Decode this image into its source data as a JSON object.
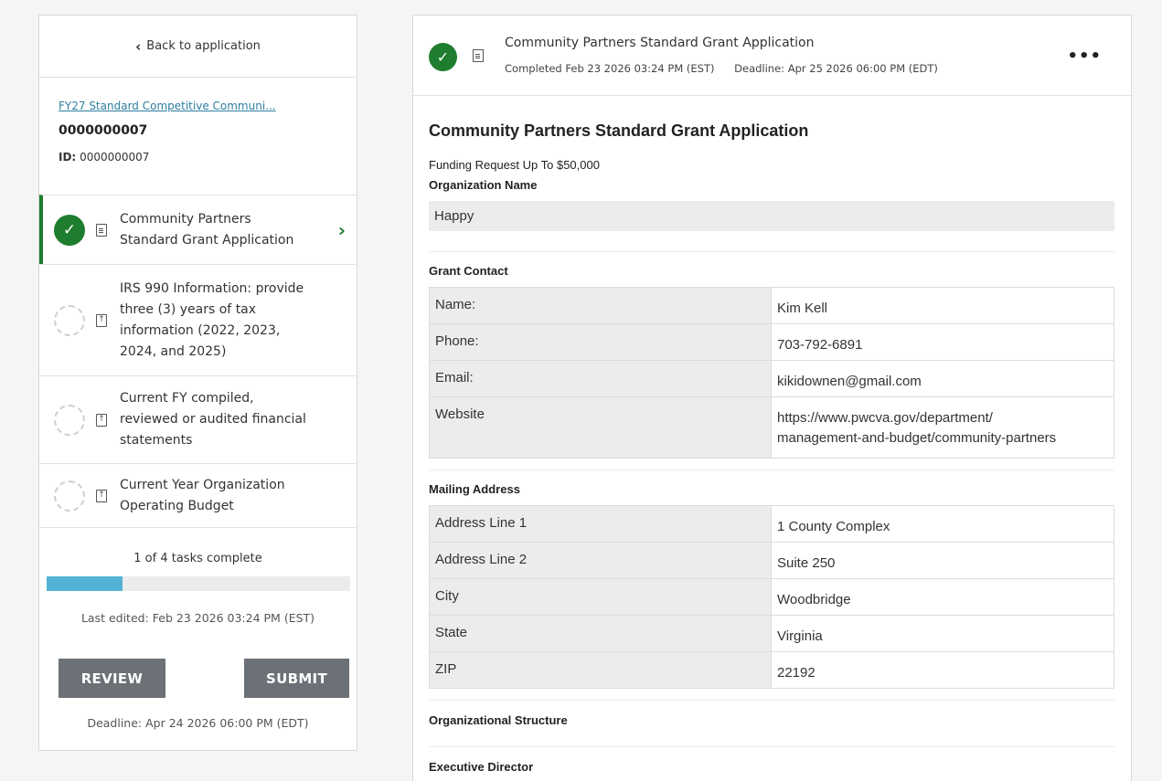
{
  "sidebar": {
    "back_label": "Back to application",
    "program_link": "FY27 Standard Competitive Communi...",
    "app_number": "0000000007",
    "id_label": "ID:",
    "id_value": "0000000007",
    "tasks": [
      {
        "label": "Community Partners Standard Grant Application",
        "status": "complete",
        "icon": "document-icon"
      },
      {
        "label": "IRS 990 Information: provide three (3) years of tax information (2022, 2023, 2024, and 2025)",
        "status": "incomplete",
        "icon": "upload-icon"
      },
      {
        "label": "Current FY compiled, reviewed or audited financial statements",
        "status": "incomplete",
        "icon": "upload-icon"
      },
      {
        "label": "Current Year Organization Operating Budget",
        "status": "incomplete",
        "icon": "upload-icon"
      }
    ],
    "progress_text": "1 of 4 tasks complete",
    "progress_fraction": 0.25,
    "last_edited": "Last edited: Feb 23 2026 03:24 PM (EST)",
    "review_label": "REVIEW",
    "submit_label": "SUBMIT",
    "deadline": "Deadline: Apr 24 2026 06:00 PM (EDT)"
  },
  "colors": {
    "complete_green": "#1e7d2e",
    "progress_blue": "#52b3d4",
    "button_gray": "#6b7176",
    "link_blue": "#2e7fa0"
  },
  "main": {
    "header_title": "Community Partners Standard Grant Application",
    "completed": "Completed Feb 23 2026 03:24 PM (EST)",
    "deadline": "Deadline: Apr 25 2026 06:00 PM (EDT)",
    "more_label": "•••",
    "form_title": "Community Partners Standard Grant Application",
    "form_subtitle": "Funding Request Up To $50,000",
    "org_name_label": "Organization Name",
    "org_name_value": "Happy",
    "grant_contact_label": "Grant Contact",
    "grant_contact": [
      {
        "key": "Name:",
        "value": "Kim Kell"
      },
      {
        "key": "Phone:",
        "value": "703-792-6891"
      },
      {
        "key": "Email:",
        "value": "kikidownen@gmail.com"
      },
      {
        "key": "Website",
        "value_line1": "https://www.pwcva.gov/department/",
        "value_line2": "management-and-budget/community-partners"
      }
    ],
    "mailing_address_label": "Mailing Address",
    "mailing_address": [
      {
        "key": "Address Line 1",
        "value": "1 County Complex"
      },
      {
        "key": "Address Line 2",
        "value": "Suite 250"
      },
      {
        "key": "City",
        "value": "Woodbridge"
      },
      {
        "key": "State",
        "value": "Virginia"
      },
      {
        "key": "ZIP",
        "value": "22192"
      }
    ],
    "org_structure_label": "Organizational Structure",
    "exec_director_label": "Executive Director"
  }
}
